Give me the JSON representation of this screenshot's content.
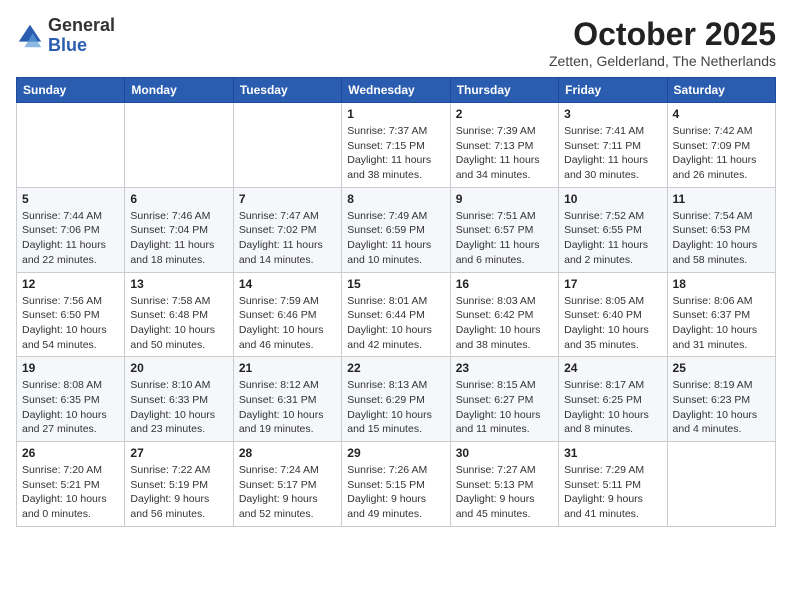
{
  "header": {
    "logo": {
      "general": "General",
      "blue": "Blue"
    },
    "title": "October 2025",
    "location": "Zetten, Gelderland, The Netherlands"
  },
  "weekdays": [
    "Sunday",
    "Monday",
    "Tuesday",
    "Wednesday",
    "Thursday",
    "Friday",
    "Saturday"
  ],
  "weeks": [
    [
      {
        "day": "",
        "info": ""
      },
      {
        "day": "",
        "info": ""
      },
      {
        "day": "",
        "info": ""
      },
      {
        "day": "1",
        "info": "Sunrise: 7:37 AM\nSunset: 7:15 PM\nDaylight: 11 hours\nand 38 minutes."
      },
      {
        "day": "2",
        "info": "Sunrise: 7:39 AM\nSunset: 7:13 PM\nDaylight: 11 hours\nand 34 minutes."
      },
      {
        "day": "3",
        "info": "Sunrise: 7:41 AM\nSunset: 7:11 PM\nDaylight: 11 hours\nand 30 minutes."
      },
      {
        "day": "4",
        "info": "Sunrise: 7:42 AM\nSunset: 7:09 PM\nDaylight: 11 hours\nand 26 minutes."
      }
    ],
    [
      {
        "day": "5",
        "info": "Sunrise: 7:44 AM\nSunset: 7:06 PM\nDaylight: 11 hours\nand 22 minutes."
      },
      {
        "day": "6",
        "info": "Sunrise: 7:46 AM\nSunset: 7:04 PM\nDaylight: 11 hours\nand 18 minutes."
      },
      {
        "day": "7",
        "info": "Sunrise: 7:47 AM\nSunset: 7:02 PM\nDaylight: 11 hours\nand 14 minutes."
      },
      {
        "day": "8",
        "info": "Sunrise: 7:49 AM\nSunset: 6:59 PM\nDaylight: 11 hours\nand 10 minutes."
      },
      {
        "day": "9",
        "info": "Sunrise: 7:51 AM\nSunset: 6:57 PM\nDaylight: 11 hours\nand 6 minutes."
      },
      {
        "day": "10",
        "info": "Sunrise: 7:52 AM\nSunset: 6:55 PM\nDaylight: 11 hours\nand 2 minutes."
      },
      {
        "day": "11",
        "info": "Sunrise: 7:54 AM\nSunset: 6:53 PM\nDaylight: 10 hours\nand 58 minutes."
      }
    ],
    [
      {
        "day": "12",
        "info": "Sunrise: 7:56 AM\nSunset: 6:50 PM\nDaylight: 10 hours\nand 54 minutes."
      },
      {
        "day": "13",
        "info": "Sunrise: 7:58 AM\nSunset: 6:48 PM\nDaylight: 10 hours\nand 50 minutes."
      },
      {
        "day": "14",
        "info": "Sunrise: 7:59 AM\nSunset: 6:46 PM\nDaylight: 10 hours\nand 46 minutes."
      },
      {
        "day": "15",
        "info": "Sunrise: 8:01 AM\nSunset: 6:44 PM\nDaylight: 10 hours\nand 42 minutes."
      },
      {
        "day": "16",
        "info": "Sunrise: 8:03 AM\nSunset: 6:42 PM\nDaylight: 10 hours\nand 38 minutes."
      },
      {
        "day": "17",
        "info": "Sunrise: 8:05 AM\nSunset: 6:40 PM\nDaylight: 10 hours\nand 35 minutes."
      },
      {
        "day": "18",
        "info": "Sunrise: 8:06 AM\nSunset: 6:37 PM\nDaylight: 10 hours\nand 31 minutes."
      }
    ],
    [
      {
        "day": "19",
        "info": "Sunrise: 8:08 AM\nSunset: 6:35 PM\nDaylight: 10 hours\nand 27 minutes."
      },
      {
        "day": "20",
        "info": "Sunrise: 8:10 AM\nSunset: 6:33 PM\nDaylight: 10 hours\nand 23 minutes."
      },
      {
        "day": "21",
        "info": "Sunrise: 8:12 AM\nSunset: 6:31 PM\nDaylight: 10 hours\nand 19 minutes."
      },
      {
        "day": "22",
        "info": "Sunrise: 8:13 AM\nSunset: 6:29 PM\nDaylight: 10 hours\nand 15 minutes."
      },
      {
        "day": "23",
        "info": "Sunrise: 8:15 AM\nSunset: 6:27 PM\nDaylight: 10 hours\nand 11 minutes."
      },
      {
        "day": "24",
        "info": "Sunrise: 8:17 AM\nSunset: 6:25 PM\nDaylight: 10 hours\nand 8 minutes."
      },
      {
        "day": "25",
        "info": "Sunrise: 8:19 AM\nSunset: 6:23 PM\nDaylight: 10 hours\nand 4 minutes."
      }
    ],
    [
      {
        "day": "26",
        "info": "Sunrise: 7:20 AM\nSunset: 5:21 PM\nDaylight: 10 hours\nand 0 minutes."
      },
      {
        "day": "27",
        "info": "Sunrise: 7:22 AM\nSunset: 5:19 PM\nDaylight: 9 hours\nand 56 minutes."
      },
      {
        "day": "28",
        "info": "Sunrise: 7:24 AM\nSunset: 5:17 PM\nDaylight: 9 hours\nand 52 minutes."
      },
      {
        "day": "29",
        "info": "Sunrise: 7:26 AM\nSunset: 5:15 PM\nDaylight: 9 hours\nand 49 minutes."
      },
      {
        "day": "30",
        "info": "Sunrise: 7:27 AM\nSunset: 5:13 PM\nDaylight: 9 hours\nand 45 minutes."
      },
      {
        "day": "31",
        "info": "Sunrise: 7:29 AM\nSunset: 5:11 PM\nDaylight: 9 hours\nand 41 minutes."
      },
      {
        "day": "",
        "info": ""
      }
    ]
  ]
}
